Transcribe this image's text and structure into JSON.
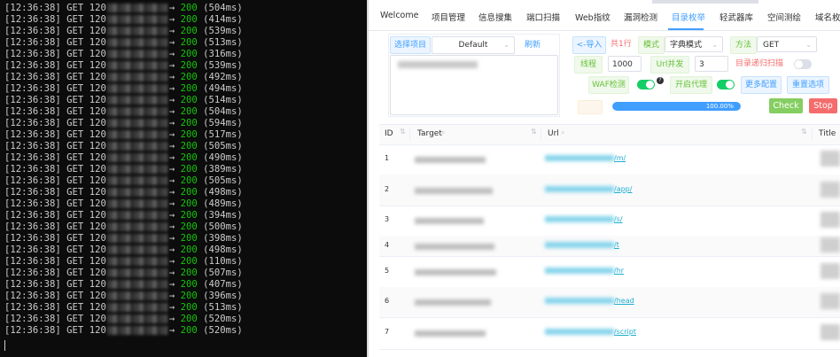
{
  "terminal": {
    "lines": [
      {
        "time": "[12:36:38]",
        "method": "GET",
        "prefix": "120",
        "arrow": "→",
        "status": "200",
        "duration": "(504ms)"
      },
      {
        "time": "[12:36:38]",
        "method": "GET",
        "prefix": "120",
        "arrow": "→",
        "status": "200",
        "duration": "(414ms)"
      },
      {
        "time": "[12:36:38]",
        "method": "GET",
        "prefix": "120",
        "arrow": "→",
        "status": "200",
        "duration": "(539ms)"
      },
      {
        "time": "[12:36:38]",
        "method": "GET",
        "prefix": "120",
        "arrow": "→",
        "status": "200",
        "duration": "(513ms)"
      },
      {
        "time": "[12:36:38]",
        "method": "GET",
        "prefix": "120",
        "arrow": "→",
        "status": "200",
        "duration": "(316ms)"
      },
      {
        "time": "[12:36:38]",
        "method": "GET",
        "prefix": "120",
        "arrow": "→",
        "status": "200",
        "duration": "(539ms)"
      },
      {
        "time": "[12:36:38]",
        "method": "GET",
        "prefix": "120",
        "arrow": "→",
        "status": "200",
        "duration": "(492ms)"
      },
      {
        "time": "[12:36:38]",
        "method": "GET",
        "prefix": "120",
        "arrow": "→",
        "status": "200",
        "duration": "(494ms)"
      },
      {
        "time": "[12:36:38]",
        "method": "GET",
        "prefix": "120",
        "arrow": "→",
        "status": "200",
        "duration": "(514ms)"
      },
      {
        "time": "[12:36:38]",
        "method": "GET",
        "prefix": "120",
        "arrow": "→",
        "status": "200",
        "duration": "(504ms)"
      },
      {
        "time": "[12:36:38]",
        "method": "GET",
        "prefix": "120",
        "arrow": "→",
        "status": "200",
        "duration": "(594ms)"
      },
      {
        "time": "[12:36:38]",
        "method": "GET",
        "prefix": "120",
        "arrow": "→",
        "status": "200",
        "duration": "(517ms)"
      },
      {
        "time": "[12:36:38]",
        "method": "GET",
        "prefix": "120",
        "arrow": "→",
        "status": "200",
        "duration": "(505ms)"
      },
      {
        "time": "[12:36:38]",
        "method": "GET",
        "prefix": "120",
        "arrow": "→",
        "status": "200",
        "duration": "(490ms)"
      },
      {
        "time": "[12:36:38]",
        "method": "GET",
        "prefix": "120",
        "arrow": "→",
        "status": "200",
        "duration": "(389ms)"
      },
      {
        "time": "[12:36:38]",
        "method": "GET",
        "prefix": "120",
        "arrow": "→",
        "status": "200",
        "duration": "(505ms)"
      },
      {
        "time": "[12:36:38]",
        "method": "GET",
        "prefix": "120",
        "arrow": "→",
        "status": "200",
        "duration": "(498ms)"
      },
      {
        "time": "[12:36:38]",
        "method": "GET",
        "prefix": "120",
        "arrow": "→",
        "status": "200",
        "duration": "(489ms)"
      },
      {
        "time": "[12:36:38]",
        "method": "GET",
        "prefix": "120",
        "arrow": "→",
        "status": "200",
        "duration": "(394ms)"
      },
      {
        "time": "[12:36:38]",
        "method": "GET",
        "prefix": "120",
        "arrow": "→",
        "status": "200",
        "duration": "(500ms)"
      },
      {
        "time": "[12:36:38]",
        "method": "GET",
        "prefix": "120",
        "arrow": "→",
        "status": "200",
        "duration": "(398ms)"
      },
      {
        "time": "[12:36:38]",
        "method": "GET",
        "prefix": "120",
        "arrow": "→",
        "status": "200",
        "duration": "(498ms)"
      },
      {
        "time": "[12:36:38]",
        "method": "GET",
        "prefix": "120",
        "arrow": "→",
        "status": "200",
        "duration": "(110ms)"
      },
      {
        "time": "[12:36:38]",
        "method": "GET",
        "prefix": "120",
        "arrow": "→",
        "status": "200",
        "duration": "(507ms)"
      },
      {
        "time": "[12:36:38]",
        "method": "GET",
        "prefix": "120",
        "arrow": "→",
        "status": "200",
        "duration": "(407ms)"
      },
      {
        "time": "[12:36:38]",
        "method": "GET",
        "prefix": "120",
        "arrow": "→",
        "status": "200",
        "duration": "(396ms)"
      },
      {
        "time": "[12:36:38]",
        "method": "GET",
        "prefix": "120",
        "arrow": "→",
        "status": "200",
        "duration": "(513ms)"
      },
      {
        "time": "[12:36:38]",
        "method": "GET",
        "prefix": "120",
        "arrow": "→",
        "status": "200",
        "duration": "(520ms)"
      },
      {
        "time": "[12:36:38]",
        "method": "GET",
        "prefix": "120",
        "arrow": "→",
        "status": "200",
        "duration": "(520ms)"
      }
    ]
  },
  "tabs": [
    "Welcome",
    "项目管理",
    "信息搜集",
    "端口扫描",
    "Web指纹",
    "漏洞检测",
    "目录枚举",
    "轻武器库",
    "空间测绘",
    "域名枚"
  ],
  "active_tab": "目录枚举",
  "controls": {
    "select_project_label": "选择项目",
    "project_value": "Default",
    "refresh_label": "刷新",
    "import_label": "<-导入",
    "count_label": "共1行",
    "mode_label": "模式",
    "mode_value": "字典模式",
    "method_label": "方法",
    "method_value": "GET",
    "threads_label": "线程",
    "threads_value": "1000",
    "url_concurrency_label": "Url并发",
    "url_concurrency_value": "3",
    "recursive_label": "目录递归扫描",
    "waf_label": "WAF检测",
    "waf_help": "?",
    "proxy_label": "开启代理",
    "more_config_label": "更多配置",
    "reset_label": "重置选项",
    "progress_percent": 100,
    "progress_text": "100.00%",
    "check_label": "Check",
    "stop_label": "Stop"
  },
  "toggles": {
    "waf": true,
    "proxy": true,
    "recursive": false
  },
  "colors": {
    "accent": "#409eff",
    "status_ok": "#16c60c",
    "toggle_on": "#13ce66",
    "check": "#85ce61",
    "stop": "#f56c6c",
    "link": "#1eaed0"
  },
  "table": {
    "headers": [
      "ID",
      "Target",
      "Url",
      "Title"
    ],
    "rows": [
      {
        "id": "1",
        "path": "/m/"
      },
      {
        "id": "2",
        "path": "/app/"
      },
      {
        "id": "3",
        "path": "/s/"
      },
      {
        "id": "4",
        "path": "/t"
      },
      {
        "id": "5",
        "path": "/hr"
      },
      {
        "id": "6",
        "path": "/head"
      },
      {
        "id": "7",
        "path": "/script"
      }
    ]
  }
}
